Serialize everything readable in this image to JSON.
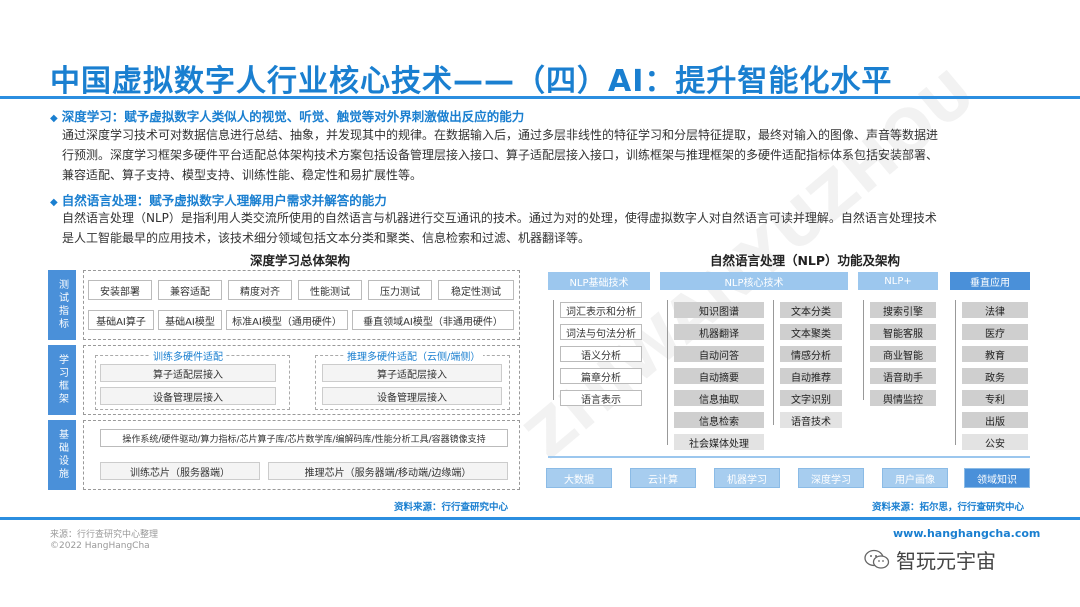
{
  "title": "中国虚拟数字人行业核心技术——（四）AI：提升智能化水平",
  "section1": {
    "heading": "深度学习：赋予虚拟数字人类似人的视觉、听觉、触觉等对外界刺激做出反应的能力",
    "line1": "通过深度学习技术可对数据信息进行总结、抽象，并发现其中的规律。在数据输入后，通过多层非线性的特征学习和分层特征提取，最终对输入的图像、声音等数据进",
    "line2": "行预测。深度学习框架多硬件平台适配总体架构技术方案包括设备管理层接入接口、算子适配层接入接口，训练框架与推理框架的多硬件适配指标体系包括安装部署、",
    "line3": "兼容适配、算子支持、模型支持、训练性能、稳定性和易扩展性等。"
  },
  "section2": {
    "heading": "自然语言处理：赋予虚拟数字人理解用户需求并解答的能力",
    "line1": "自然语言处理（NLP）是指利用人类交流所使用的自然语言与机器进行交互通讯的技术。通过为对的处理，使得虚拟数字人对自然语言可读并理解。自然语言处理技术",
    "line2": "是人工智能最早的应用技术，该技术细分领域包括文本分类和聚类、信息检索和过滤、机器翻译等。"
  },
  "left_diagram": {
    "title": "深度学习总体架构",
    "side1": "测试指标",
    "side2": "学习框架",
    "side3": "基础设施",
    "metrics_row1": [
      "安装部署",
      "兼容适配",
      "精度对齐",
      "性能测试",
      "压力测试",
      "稳定性测试"
    ],
    "metrics_row2": [
      "基础AI算子",
      "基础AI模型",
      "标准AI模型（通用硬件）",
      "垂直领域AI模型（非通用硬件）"
    ],
    "train_label": "训练多硬件适配",
    "infer_label": "推理多硬件适配（云侧/端侧）",
    "train_boxes": [
      "算子适配层接入",
      "设备管理层接入"
    ],
    "infer_boxes": [
      "算子适配层接入",
      "设备管理层接入"
    ],
    "infra_row1": "操作系统/硬件驱动/算力指标/芯片算子库/芯片数学库/编解码库/性能分析工具/容器镜像支持",
    "infra_row2": [
      "训练芯片（服务器端）",
      "推理芯片（服务器端/移动端/边缘端）"
    ],
    "source": "资料来源：行行查研究中心"
  },
  "right_diagram": {
    "title": "自然语言处理（NLP）功能及架构",
    "col1_header": "NLP基础技术",
    "col1": [
      "词汇表示和分析",
      "词法与句法分析",
      "语义分析",
      "篇章分析",
      "语言表示"
    ],
    "col2_header": "NLP核心技术",
    "col2a": [
      "知识图谱",
      "机器翻译",
      "自动问答",
      "自动摘要",
      "信息抽取",
      "信息检索",
      "社会媒体处理"
    ],
    "col2b": [
      "文本分类",
      "文本聚类",
      "情感分析",
      "自动推荐",
      "文字识别",
      "语音技术"
    ],
    "col3_header": "NLP+",
    "col3": [
      "搜索引擎",
      "智能客服",
      "商业智能",
      "语音助手",
      "舆情监控"
    ],
    "col4_header": "垂直应用",
    "col4": [
      "法律",
      "医疗",
      "教育",
      "政务",
      "专利",
      "出版",
      "公安"
    ],
    "bottom": [
      "大数据",
      "云计算",
      "机器学习",
      "深度学习",
      "用户画像",
      "领域知识"
    ],
    "source": "资料来源：拓尔思，行行查研究中心"
  },
  "footer": {
    "source": "来源：行行查研究中心整理",
    "copyright": "©2022 HangHangCha",
    "url": "www.hanghangcha.com",
    "wechat": "智玩元宇宙"
  },
  "colors": {
    "accent": "#1a7fd0",
    "box_blue": "#4a90d9",
    "box_light_blue": "#9cc7ee",
    "box_grey": "#cfcfcf"
  }
}
